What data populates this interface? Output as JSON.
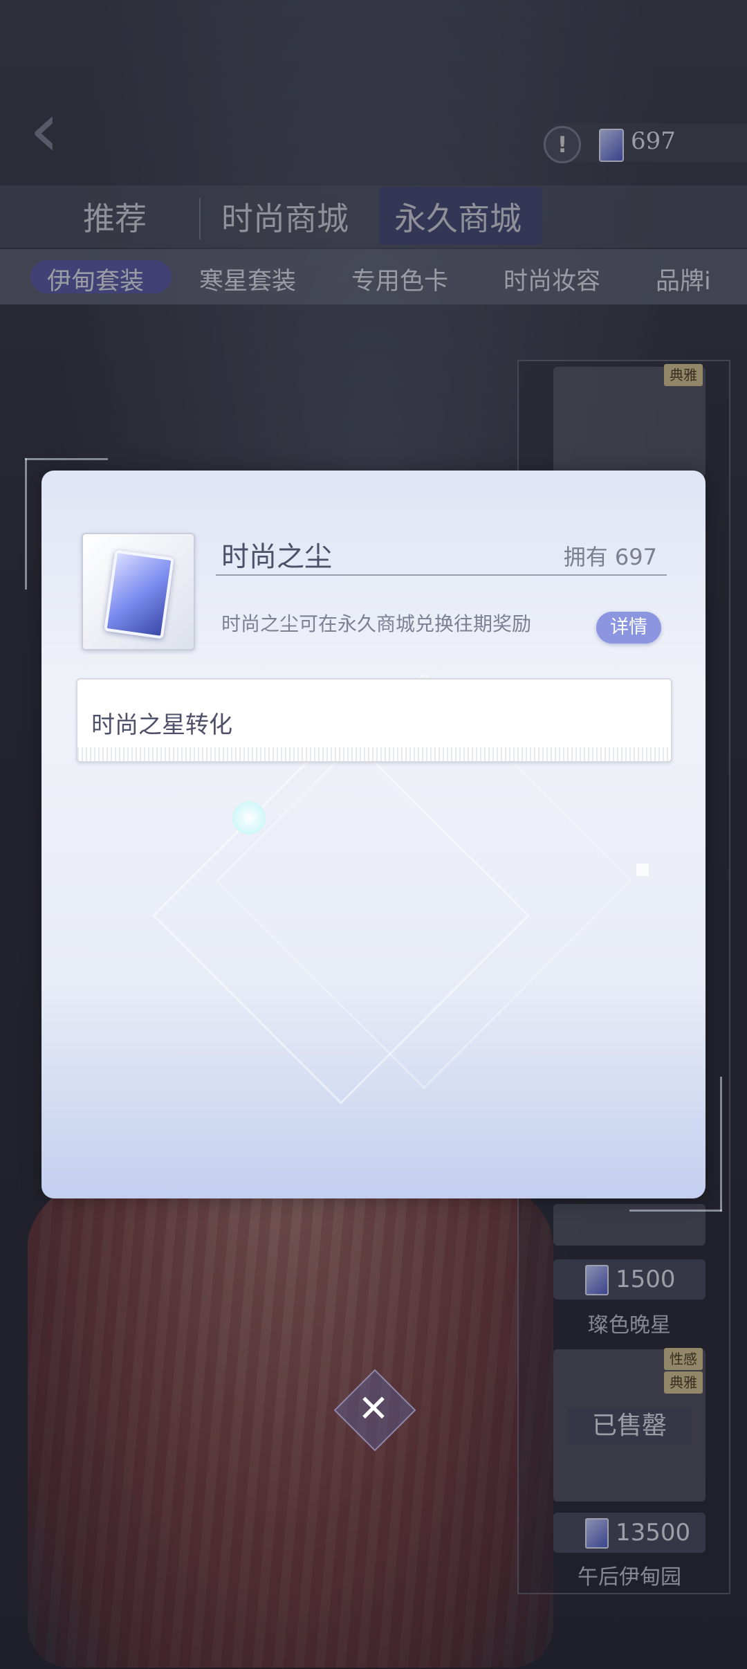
{
  "header": {
    "currency_value": "697"
  },
  "main_tabs": [
    {
      "label": "推荐"
    },
    {
      "label": "时尚商城"
    },
    {
      "label": "永久商城",
      "active": true
    }
  ],
  "sub_tabs": [
    {
      "label": "伊甸套装",
      "active": true
    },
    {
      "label": "寒星套装"
    },
    {
      "label": "专用色卡"
    },
    {
      "label": "时尚妆容"
    },
    {
      "label": "品牌i"
    }
  ],
  "right_panel": {
    "cards": [
      {
        "tag1": "典雅"
      },
      {
        "price": "1500",
        "name": "璨色晚星"
      },
      {
        "tag1": "性感",
        "tag2": "典雅",
        "status": "已售罄",
        "price": "13500",
        "name": "午后伊甸园"
      }
    ]
  },
  "dialog": {
    "item_name": "时尚之尘",
    "owned_text": "拥有 697",
    "description": "时尚之尘可在永久商城兑换往期奖励",
    "detail_button": "详情",
    "convert_label": "时尚之星转化"
  },
  "colors": {
    "accent": "#8b95e0",
    "active_tab": "#5a5aa6"
  },
  "icons": [
    "back-arrow-icon",
    "warning-icon",
    "gem-icon",
    "close-icon"
  ]
}
